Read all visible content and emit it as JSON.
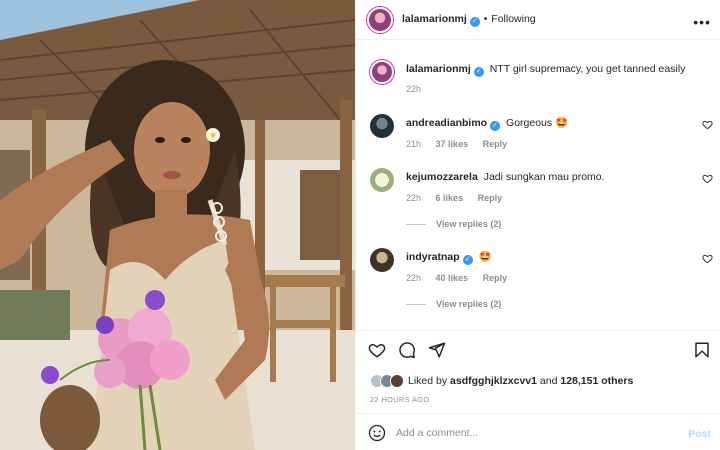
{
  "post": {
    "author": "lalamarionmj",
    "follow_status": "Following",
    "dot": "•",
    "more_icon": "more-options-icon"
  },
  "caption": {
    "username": "lalamarionmj",
    "text": "NTT girl supremacy, you get tanned easily",
    "time": "22h"
  },
  "comments": [
    {
      "username": "andreadianbimo",
      "text": "Gorgeous 🤩",
      "time": "21h",
      "likes": "37 likes",
      "reply": "Reply",
      "verified": true
    },
    {
      "username": "kejumozzarela",
      "text": "Jadi sungkan mau promo.",
      "time": "22h",
      "likes": "6 likes",
      "reply": "Reply",
      "view_replies": "View replies (2)",
      "verified": false
    },
    {
      "username": "indyratnap",
      "text": "🤩",
      "time": "22h",
      "likes": "40 likes",
      "reply": "Reply",
      "view_replies": "View replies (2)",
      "verified": true
    }
  ],
  "likes": {
    "prefix": "Liked by",
    "user": "asdfgghjklzxcvv1",
    "and": "and",
    "others": "128,151 others"
  },
  "timestamp": "22 HOURS AGO",
  "add_comment": {
    "placeholder": "Add a comment...",
    "post_label": "Post"
  },
  "colors": {
    "verified": "#3897f0",
    "post_disabled": "#b3dbff",
    "muted": "#8e8e8e"
  }
}
